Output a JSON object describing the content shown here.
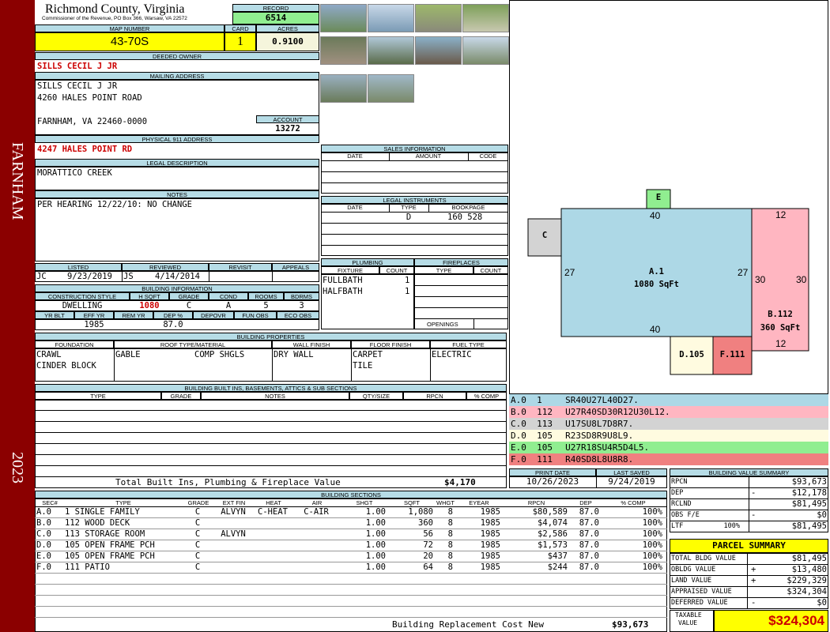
{
  "side": {
    "location": "FARNHAM",
    "year": "2023"
  },
  "header": {
    "county": "Richmond County, Virginia",
    "address_line": "Commissioner of the Revenue, PO Box 366, Warsaw, VA 22572",
    "record_label": "RECORD",
    "record": "6514"
  },
  "map": {
    "map_label": "MAP NUMBER",
    "map_number": "43-70S",
    "card_label": "CARD",
    "card": "1",
    "acres_label": "ACRES",
    "acres": "0.9100"
  },
  "owner": {
    "deeded_label": "DEEDED OWNER",
    "deeded_owner": "SILLS CECIL J JR",
    "mailing_label": "MAILING ADDRESS",
    "mail1": "SILLS CECIL J JR",
    "mail2": "4260 HALES POINT ROAD",
    "mail3": "FARNHAM, VA 22460-0000",
    "account_label": "ACCOUNT",
    "account": "13272"
  },
  "physical": {
    "label": "PHYSICAL 911 ADDRESS",
    "address": "4247 HALES POINT RD"
  },
  "legal": {
    "label": "LEGAL DESCRIPTION",
    "text": "MORATTICO CREEK"
  },
  "notes": {
    "label": "NOTES",
    "text": "PER HEARING 12/22/10: NO CHANGE"
  },
  "sales": {
    "label": "SALES INFORMATION",
    "cols": [
      "DATE",
      "AMOUNT",
      "CODE"
    ]
  },
  "instruments": {
    "label": "LEGAL INSTRUMENTS",
    "cols": [
      "DATE",
      "TYPE",
      "BOOKPAGE"
    ],
    "type": "D",
    "bookpage": "160 528"
  },
  "listed": {
    "listed_label": "LISTED",
    "reviewed_label": "REVIEWED",
    "revisit_label": "REVISIT",
    "appeals_label": "APPEALS",
    "lister": "JC",
    "listed_date": "9/23/2019",
    "reviewer": "JS",
    "reviewed_date": "4/14/2014"
  },
  "building": {
    "label": "BUILDING INFORMATION",
    "cols": [
      "CONSTRUCTION STYLE",
      "H SQFT",
      "GRADE",
      "COND",
      "ROOMS",
      "BDRMS"
    ],
    "style": "DWELLING",
    "hsqft": "1080",
    "grade": "C",
    "cond": "A",
    "rooms": "5",
    "bdrms": "3",
    "cols2": [
      "YR BLT",
      "EFF YR",
      "REM YR",
      "DEP %",
      "DEPOVR",
      "FUN OBS",
      "ECO OBS"
    ],
    "effyr": "1985",
    "dep": "87.0"
  },
  "plumbing": {
    "label": "PLUMBING",
    "cols": [
      "FIXTURE",
      "COUNT"
    ],
    "rows": [
      [
        "FULLBATH",
        "1"
      ],
      [
        "HALFBATH",
        "1"
      ]
    ]
  },
  "fireplaces": {
    "label": "FIREPLACES",
    "cols": [
      "TYPE",
      "COUNT"
    ],
    "openings": "OPENINGS"
  },
  "properties": {
    "label": "BUILDING PROPERTIES",
    "cols": [
      "FOUNDATION",
      "ROOF TYPE/MATERIAL",
      "WALL FINISH",
      "FLOOR FINISH",
      "FUEL TYPE"
    ],
    "foundation1": "CRAWL",
    "foundation2": "CINDER BLOCK",
    "roof1": "GABLE",
    "roof2": "COMP SHGLS",
    "wall": "DRY WALL",
    "floor1": "CARPET",
    "floor2": "TILE",
    "fuel": "ELECTRIC"
  },
  "builtins": {
    "label": "BUILDING BUILT INS, BASEMENTS, ATTICS & SUB SECTIONS",
    "cols": [
      "TYPE",
      "GRADE",
      "NOTES",
      "QTY/SIZE",
      "RPCN",
      "% COMP"
    ],
    "total_label": "Total Built Ins, Plumbing & Fireplace Value",
    "total": "$4,170"
  },
  "print": {
    "print_label": "PRINT DATE",
    "saved_label": "LAST SAVED",
    "print_date": "10/26/2023",
    "saved_date": "9/24/2019"
  },
  "sketch": {
    "sections": [
      {
        "code": "A.0",
        "num": "1",
        "desc": "SR40U27L40D27.",
        "color": "#add8e6"
      },
      {
        "code": "B.0",
        "num": "112",
        "desc": "U27R40SD30R12U30L12.",
        "color": "#ffb6c1"
      },
      {
        "code": "C.0",
        "num": "113",
        "desc": "U17SU8L7D8R7.",
        "color": "#d3d3d3"
      },
      {
        "code": "D.0",
        "num": "105",
        "desc": "R23SD8R9U8L9.",
        "color": "#fffbe0"
      },
      {
        "code": "E.0",
        "num": "105",
        "desc": "U27R18SU4R5D4L5.",
        "color": "#90ee90"
      },
      {
        "code": "F.0",
        "num": "111",
        "desc": "R40SD8L8U8R8.",
        "color": "#f08080"
      }
    ],
    "labels": {
      "a": "A.1",
      "a_sqft": "1080 SqFt",
      "b": "B.112",
      "b_sqft": "360 SqFt",
      "c": "C",
      "d": "D.105",
      "e": "E",
      "f": "F.111",
      "d40top": "40",
      "d40bot": "40",
      "d27l": "27",
      "d27r": "27",
      "d12t": "12",
      "d12b": "12",
      "d30l": "30",
      "d30r": "30"
    }
  },
  "sections": {
    "label": "BUILDING SECTIONS",
    "cols": [
      "SEC#",
      "TYPE",
      "GRADE",
      "EXT FIN",
      "HEAT",
      "AIR",
      "SHGT",
      "SQFT",
      "WHGT",
      "EYEAR",
      "RPCN",
      "DEP",
      "% COMP"
    ],
    "rows": [
      [
        "A.0",
        "1 SINGLE FAMILY",
        "C",
        "ALVYN",
        "C-HEAT",
        "C-AIR",
        "1.00",
        "1,080",
        "8",
        "1985",
        "$80,589",
        "87.0",
        "100%"
      ],
      [
        "B.0",
        "112 WOOD DECK",
        "C",
        "",
        "",
        "",
        "1.00",
        "360",
        "8",
        "1985",
        "$4,074",
        "87.0",
        "100%"
      ],
      [
        "C.0",
        "113 STORAGE ROOM",
        "C",
        "ALVYN",
        "",
        "",
        "1.00",
        "56",
        "8",
        "1985",
        "$2,586",
        "87.0",
        "100%"
      ],
      [
        "D.0",
        "105 OPEN FRAME PCH",
        "C",
        "",
        "",
        "",
        "1.00",
        "72",
        "8",
        "1985",
        "$1,573",
        "87.0",
        "100%"
      ],
      [
        "E.0",
        "105 OPEN FRAME PCH",
        "C",
        "",
        "",
        "",
        "1.00",
        "20",
        "8",
        "1985",
        "$437",
        "87.0",
        "100%"
      ],
      [
        "F.0",
        "111 PATIO",
        "C",
        "",
        "",
        "",
        "1.00",
        "64",
        "8",
        "1985",
        "$244",
        "87.0",
        "100%"
      ]
    ],
    "total_label": "Building Replacement Cost New",
    "total": "$93,673"
  },
  "value_summary": {
    "label": "BUILDING VALUE SUMMARY",
    "rows": [
      [
        "RPCN",
        "",
        "$93,673"
      ],
      [
        "DEP",
        "-",
        "$12,178"
      ],
      [
        "RCLND",
        "",
        "$81,495"
      ],
      [
        "OBS F/E",
        "-",
        "$0"
      ],
      [
        "LTF          100%",
        "",
        "$81,495"
      ]
    ]
  },
  "parcel": {
    "label": "PARCEL SUMMARY",
    "rows": [
      [
        "TOTAL BLDG VALUE",
        "",
        "$81,495"
      ],
      [
        "OBLDG VALUE",
        "+",
        "$13,480"
      ],
      [
        "LAND VALUE",
        "+",
        "$229,329"
      ],
      [
        "APPRAISED VALUE",
        "",
        "$324,304"
      ],
      [
        "DEFERRED VALUE",
        "-",
        "$0"
      ]
    ],
    "taxable_label1": "TAXABLE",
    "taxable_label2": "VALUE",
    "taxable": "$324,304"
  }
}
